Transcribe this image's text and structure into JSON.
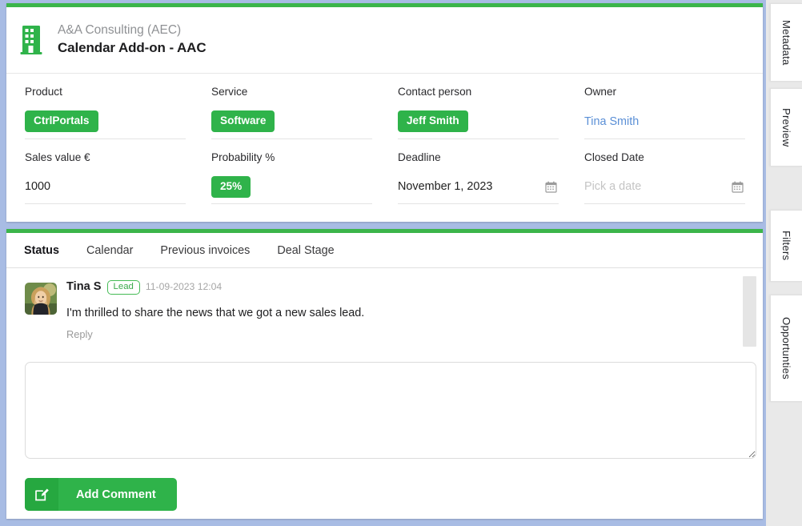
{
  "header": {
    "icon": "building-icon",
    "company": "A&A Consulting (AEC)",
    "title": "Calendar Add-on - AAC"
  },
  "fields": {
    "row1": [
      {
        "label": "Product",
        "value": "CtrlPortals",
        "style": "pill"
      },
      {
        "label": "Service",
        "value": "Software",
        "style": "pill"
      },
      {
        "label": "Contact person",
        "value": "Jeff Smith",
        "style": "pill"
      },
      {
        "label": "Owner",
        "value": "Tina Smith",
        "style": "link"
      }
    ],
    "row2": [
      {
        "label": "Sales value €",
        "value": "1000",
        "style": "text"
      },
      {
        "label": "Probability %",
        "value": "25%",
        "style": "pill"
      },
      {
        "label": "Deadline",
        "value": "November 1, 2023",
        "style": "date",
        "icon": "calendar-icon"
      },
      {
        "label": "Closed Date",
        "value": "Pick a date",
        "style": "placeholder",
        "icon": "calendar-icon"
      }
    ]
  },
  "tabs": [
    {
      "label": "Status",
      "active": true
    },
    {
      "label": "Calendar",
      "active": false
    },
    {
      "label": "Previous invoices",
      "active": false
    },
    {
      "label": "Deal Stage",
      "active": false
    }
  ],
  "comment": {
    "author": "Tina S",
    "role_badge": "Lead",
    "timestamp": "11-09-2023 12:04",
    "text": "I'm thrilled to share the news that we got a new sales lead.",
    "reply_label": "Reply"
  },
  "composer": {
    "placeholder": "",
    "value": "",
    "submit_label": "Add Comment",
    "submit_icon": "edit-square-icon"
  },
  "right_rail": [
    {
      "label": "Metadata",
      "active": false
    },
    {
      "label": "Preview",
      "active": false
    },
    {
      "label": "Filters",
      "active": false
    },
    {
      "label": "Opportunties",
      "active": true
    }
  ],
  "colors": {
    "accent_green": "#2fb34a",
    "card_top_bar": "#3bb54a",
    "page_background": "#a8bce4",
    "link_blue": "#5a8fd6",
    "rail_active": "#5e8fd2"
  }
}
